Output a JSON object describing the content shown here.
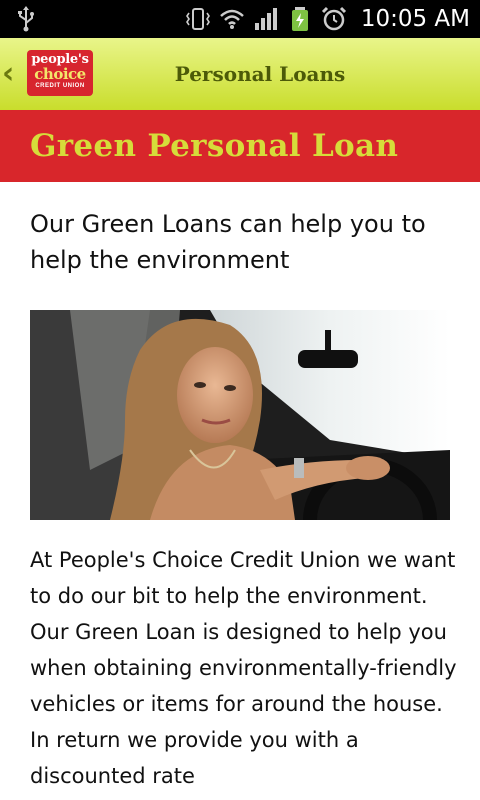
{
  "status_bar": {
    "time": "10:05 AM",
    "icons": [
      "usb-icon",
      "vibrate-icon",
      "wifi-icon",
      "signal-icon",
      "battery-charging-icon",
      "alarm-icon"
    ]
  },
  "header": {
    "back_icon": "chevron-left-icon",
    "logo": {
      "line1": "people's",
      "line2": "choice",
      "line3": "CREDIT UNION"
    },
    "title": "Personal Loans"
  },
  "banner": {
    "title": "Green Personal Loan"
  },
  "content": {
    "subheading": "Our Green Loans can help you to help the environment",
    "image_description": "photo-woman-in-car",
    "body": "At People's Choice Credit Union we want to do our bit to help the environment. Our Green Loan is designed to help you when obtaining environmentally-friendly vehicles or items for around the house. In return we provide you with a discounted rate"
  },
  "colors": {
    "header_green": "#c9dd2c",
    "banner_red": "#d8262b",
    "banner_text": "#d6dc3a",
    "logo_red": "#d7252e"
  }
}
